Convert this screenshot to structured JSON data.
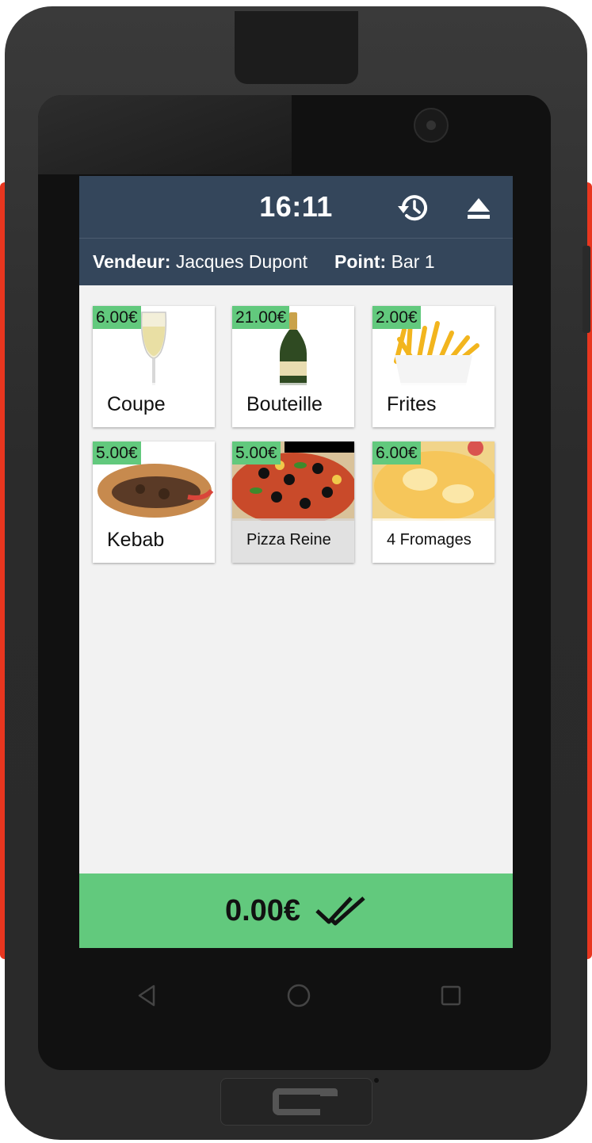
{
  "status": {
    "time": "16:11"
  },
  "header": {
    "seller_label": "Vendeur:",
    "seller_name": "Jacques Dupont",
    "point_label": "Point:",
    "point_name": "Bar 1"
  },
  "products": [
    {
      "price": "6.00€",
      "label": "Coupe",
      "image": "champagne-glass"
    },
    {
      "price": "21.00€",
      "label": "Bouteille",
      "image": "champagne-bottle"
    },
    {
      "price": "2.00€",
      "label": "Frites",
      "image": "french-fries"
    },
    {
      "price": "5.00€",
      "label": "Kebab",
      "image": "kebab"
    },
    {
      "price": "5.00€",
      "label": "Pizza Reine",
      "image": "pizza"
    },
    {
      "price": "6.00€",
      "label": "4 Fromages",
      "image": "cheese-pizza"
    }
  ],
  "footer": {
    "total": "0.00€",
    "validate_icon": "double-check-icon"
  },
  "icons": {
    "history": "history-icon",
    "eject": "eject-icon"
  },
  "colors": {
    "header": "#34465b",
    "accent": "#62c97d",
    "background": "#f2f2f2"
  }
}
